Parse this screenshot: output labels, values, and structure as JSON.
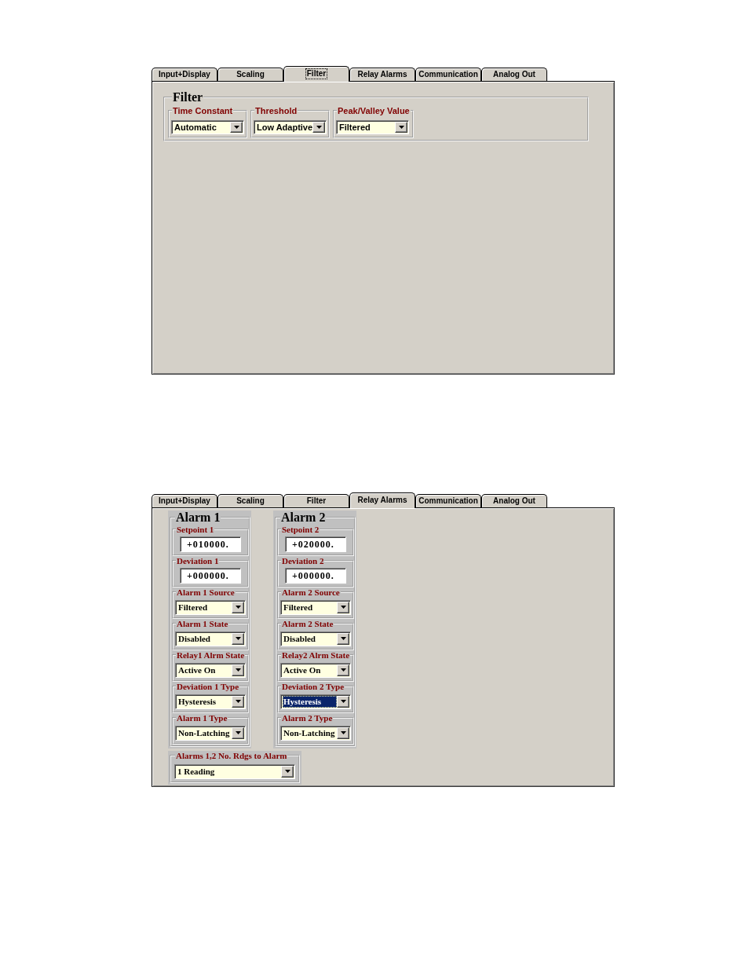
{
  "panels": [
    {
      "kind": "row",
      "tabs": [
        {
          "label": "Input+Display",
          "selected": false,
          "focused": false
        },
        {
          "label": "Scaling",
          "selected": false,
          "focused": false
        },
        {
          "label": "Filter",
          "selected": true,
          "focused": true
        },
        {
          "label": "Relay Alarms",
          "selected": false,
          "focused": false
        },
        {
          "label": "Communication",
          "selected": false,
          "focused": false
        },
        {
          "label": "Analog Out",
          "selected": false,
          "focused": false
        }
      ],
      "groups": [
        {
          "title": "Filter",
          "fields": [
            {
              "label": "Time Constant",
              "kind": "select",
              "value": "Automatic",
              "highlighted": false
            },
            {
              "label": "Threshold",
              "kind": "select",
              "value": "Low Adaptive",
              "highlighted": false
            },
            {
              "label": "Peak/Valley Value",
              "kind": "select",
              "value": "Filtered",
              "highlighted": false
            }
          ]
        }
      ]
    },
    {
      "kind": "columns",
      "tabs": [
        {
          "label": "Input+Display",
          "selected": false,
          "focused": false
        },
        {
          "label": "Scaling",
          "selected": false,
          "focused": false
        },
        {
          "label": "Filter",
          "selected": false,
          "focused": false
        },
        {
          "label": "Relay Alarms",
          "selected": true,
          "focused": false
        },
        {
          "label": "Communication",
          "selected": false,
          "focused": false
        },
        {
          "label": "Analog Out",
          "selected": false,
          "focused": false
        }
      ],
      "groups": [
        {
          "title": "Alarm 1",
          "fields": [
            {
              "label": "Setpoint 1",
              "kind": "text",
              "value": "+010000.",
              "highlighted": false
            },
            {
              "label": "Deviation 1",
              "kind": "text",
              "value": "+000000.",
              "highlighted": false
            },
            {
              "label": "Alarm 1 Source",
              "kind": "select",
              "value": "Filtered",
              "highlighted": false
            },
            {
              "label": "Alarm 1 State",
              "kind": "select",
              "value": "Disabled",
              "highlighted": false
            },
            {
              "label": "Relay1 Alrm State",
              "kind": "select",
              "value": "Active On",
              "highlighted": false
            },
            {
              "label": "Deviation 1 Type",
              "kind": "select",
              "value": "Hysteresis",
              "highlighted": false
            },
            {
              "label": "Alarm 1 Type",
              "kind": "select",
              "value": "Non-Latching",
              "highlighted": false
            }
          ]
        },
        {
          "title": "Alarm 2",
          "fields": [
            {
              "label": "Setpoint 2",
              "kind": "text",
              "value": "+020000.",
              "highlighted": false
            },
            {
              "label": "Deviation 2",
              "kind": "text",
              "value": "+000000.",
              "highlighted": false
            },
            {
              "label": "Alarm 2 Source",
              "kind": "select",
              "value": "Filtered",
              "highlighted": false
            },
            {
              "label": "Alarm 2 State",
              "kind": "select",
              "value": "Disabled",
              "highlighted": false
            },
            {
              "label": "Relay2 Alrm State",
              "kind": "select",
              "value": "Active On",
              "highlighted": false
            },
            {
              "label": "Deviation 2 Type",
              "kind": "select",
              "value": "Hysteresis",
              "highlighted": true
            },
            {
              "label": "Alarm 2 Type",
              "kind": "select",
              "value": "Non-Latching",
              "highlighted": false
            }
          ]
        }
      ],
      "footer": {
        "label": "Alarms 1,2 No. Rdgs to Alarm",
        "kind": "select",
        "value": "1 Reading",
        "highlighted": false
      }
    }
  ]
}
